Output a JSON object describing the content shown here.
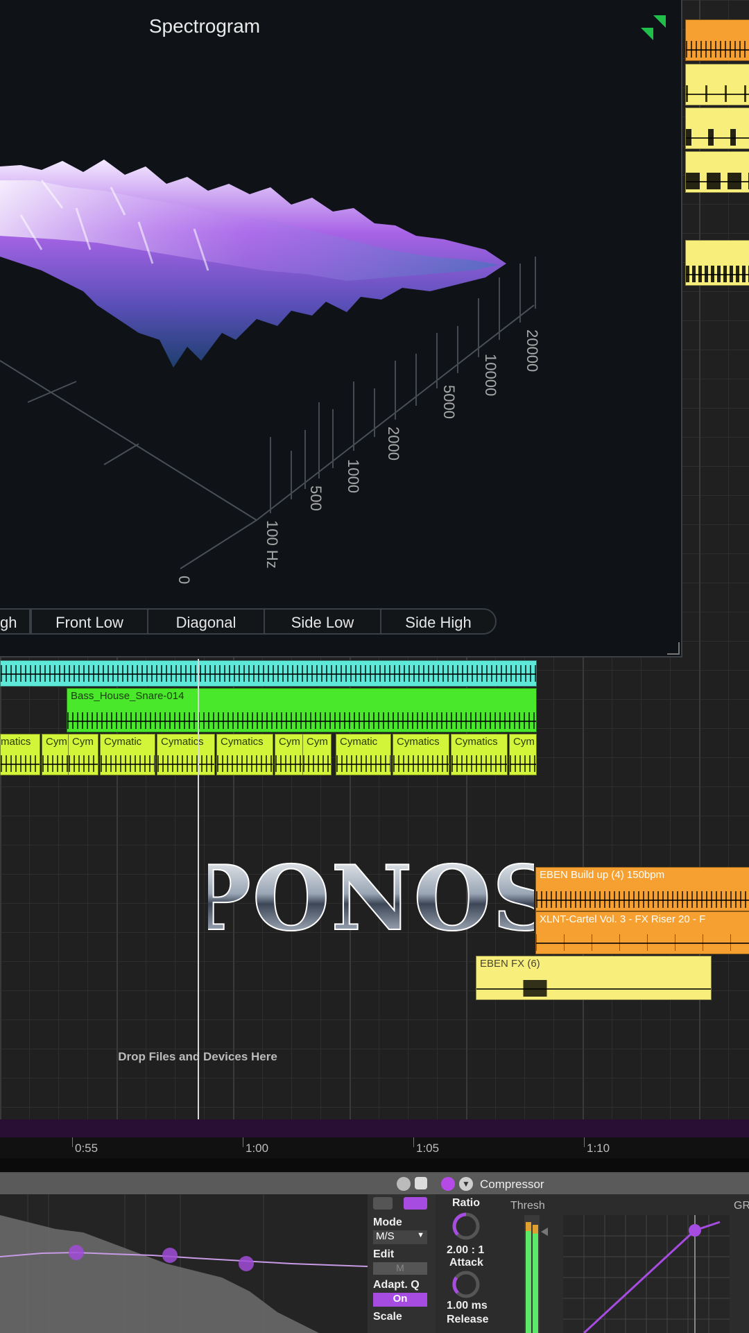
{
  "spectrogram": {
    "title": "Spectrogram",
    "freq_axis": [
      "20000",
      "10000",
      "5000",
      "2000",
      "1000",
      "500",
      "100\nHz"
    ],
    "time_axis_label": "0",
    "view_buttons": [
      "gh",
      "Front Low",
      "Diagonal",
      "Side Low",
      "Side High"
    ],
    "colors": {
      "surface_low": "#2a66a8",
      "surface_mid": "#9a5bdc",
      "surface_high": "#f2e6ff",
      "logo": "#1fbf4a"
    }
  },
  "clips": {
    "snare": "Bass_House_Snare-014",
    "cymatics": [
      "matics",
      "Cym",
      "Cym",
      "Cymatic",
      "Cymatics",
      "Cymatics",
      "Cym",
      "Cym",
      "Cymatic",
      "Cymatics",
      "Cymatics",
      "Cym"
    ],
    "build_up": "EBEN Build up (4) 150bpm",
    "riser": "XLNT-Cartel Vol. 3 - FX Riser 20 - F",
    "fx": "EBEN FX (6)",
    "colors": {
      "cyan": "#5de8d8",
      "green": "#4ae82a",
      "lime": "#d2f53a",
      "orange": "#f5a030",
      "yellow": "#f7ee7c"
    }
  },
  "overlay_logo": "PONOS",
  "drop_hint": "Drop Files and Devices Here",
  "ruler": {
    "labels": [
      "0:55",
      "1:00",
      "1:05",
      "1:10"
    ]
  },
  "devices": {
    "eq": {
      "mode_label": "Mode",
      "mode_value": "M/S",
      "edit_label": "Edit",
      "edit_value": "M",
      "adapt_q_label": "Adapt. Q",
      "adapt_q_value": "On",
      "scale_label": "Scale"
    },
    "compressor": {
      "title": "Compressor",
      "ratio_label": "Ratio",
      "ratio_value": "2.00 : 1",
      "attack_label": "Attack",
      "attack_value": "1.00 ms",
      "release_label": "Release",
      "thresh_label": "Thresh",
      "gr_label": "GR"
    }
  }
}
